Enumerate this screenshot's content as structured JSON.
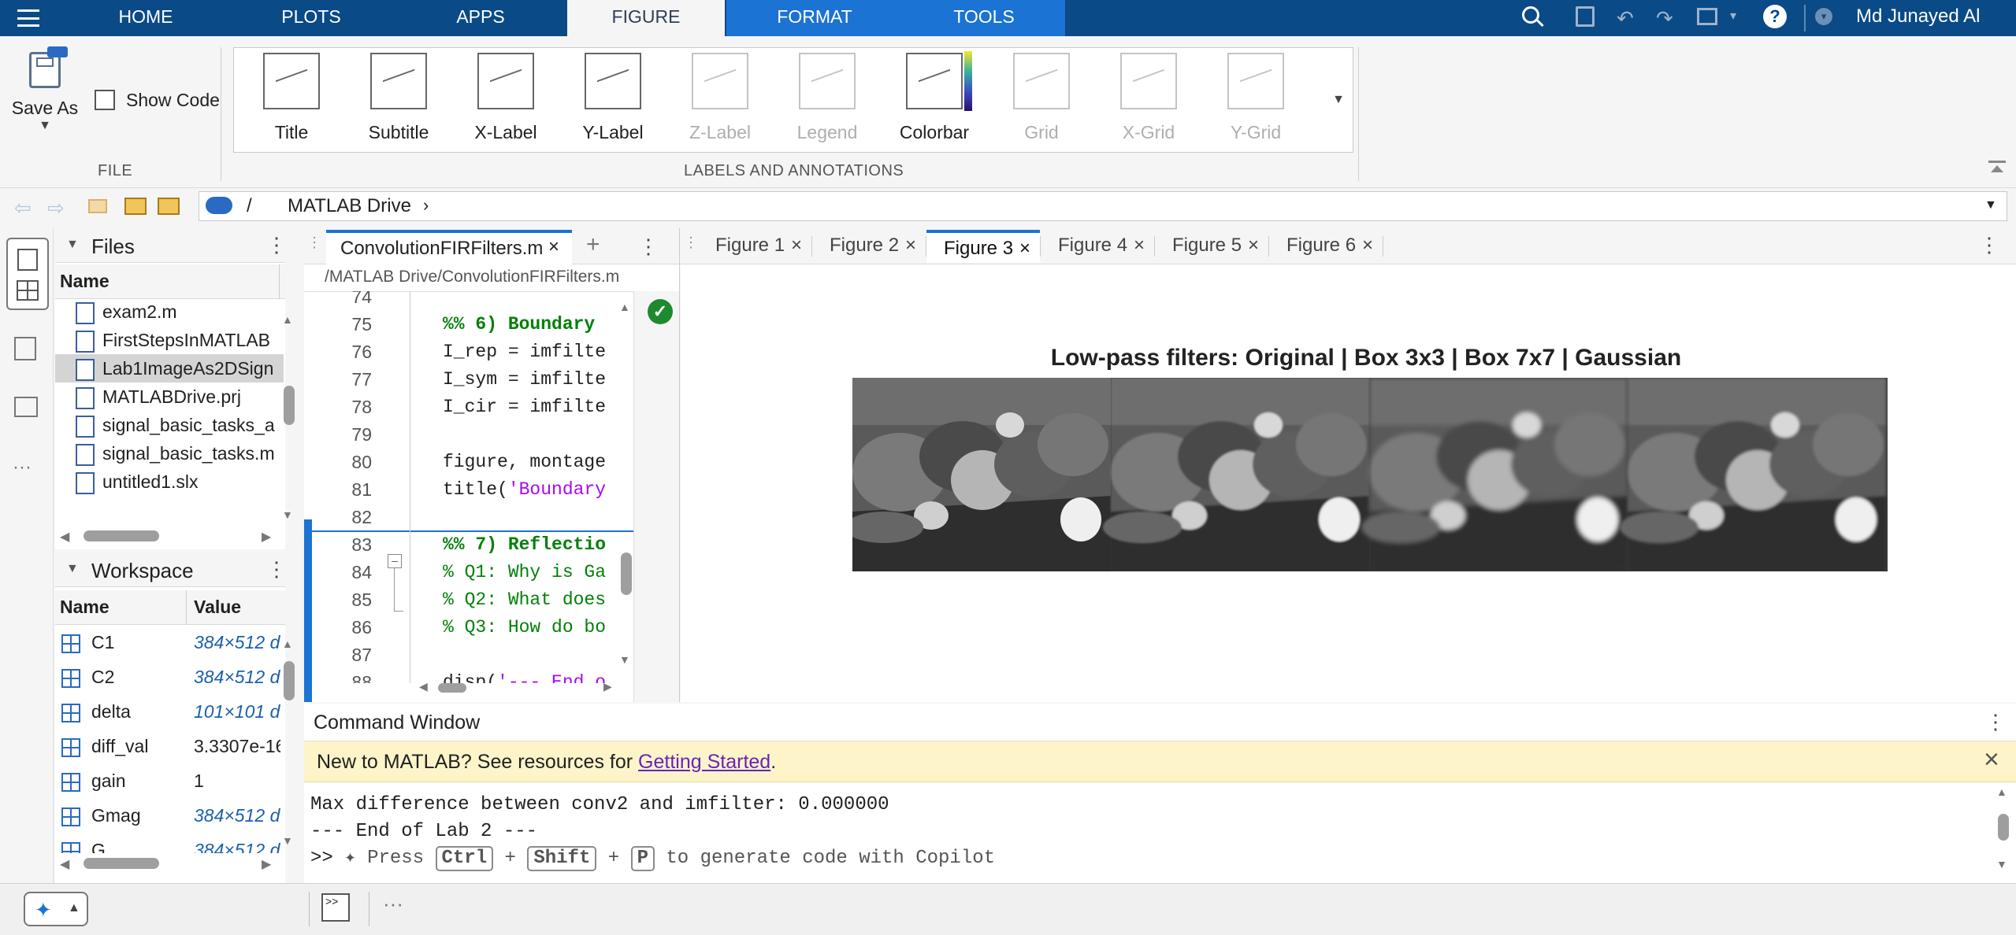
{
  "tabs": {
    "home": "HOME",
    "plots": "PLOTS",
    "apps": "APPS",
    "figure": "FIGURE",
    "format": "FORMAT",
    "tools": "TOOLS"
  },
  "user": "Md Junayed Al",
  "ribbon": {
    "save_as": "Save As",
    "show_code": "Show Code",
    "file_section": "FILE",
    "labels_section": "LABELS AND ANNOTATIONS",
    "gallery": [
      {
        "label": "Title",
        "enabled": true
      },
      {
        "label": "Subtitle",
        "enabled": true
      },
      {
        "label": "X-Label",
        "enabled": true
      },
      {
        "label": "Y-Label",
        "enabled": true
      },
      {
        "label": "Z-Label",
        "enabled": false
      },
      {
        "label": "Legend",
        "enabled": false
      },
      {
        "label": "Colorbar",
        "enabled": true
      },
      {
        "label": "Grid",
        "enabled": false
      },
      {
        "label": "X-Grid",
        "enabled": false
      },
      {
        "label": "Y-Grid",
        "enabled": false
      }
    ]
  },
  "address": {
    "root": "/",
    "folder": "MATLAB Drive"
  },
  "files": {
    "title": "Files",
    "col": "Name",
    "items": [
      "exam2.m",
      "FirstStepsInMATLAB",
      "Lab1ImageAs2DSign",
      "MATLABDrive.prj",
      "signal_basic_tasks_a",
      "signal_basic_tasks.m",
      "untitled1.slx"
    ]
  },
  "workspace": {
    "title": "Workspace",
    "col_name": "Name",
    "col_value": "Value",
    "rows": [
      {
        "name": "C1",
        "value": "384×512 d"
      },
      {
        "name": "C2",
        "value": "384×512 d"
      },
      {
        "name": "delta",
        "value": "101×101 d"
      },
      {
        "name": "diff_val",
        "value": "3.3307e-16"
      },
      {
        "name": "gain",
        "value": "1"
      },
      {
        "name": "Gmag",
        "value": "384×512 d"
      },
      {
        "name": "G",
        "value": "384×512 d"
      }
    ]
  },
  "editor": {
    "tab": "ConvolutionFIRFilters.m",
    "path": "/MATLAB Drive/ConvolutionFIRFilters.m",
    "lines": [
      {
        "n": "74",
        "code": ""
      },
      {
        "n": "75",
        "code": "%% 6) Boundary",
        "type": "section"
      },
      {
        "n": "76",
        "code": "I_rep = imfilte",
        "type": "code"
      },
      {
        "n": "77",
        "code": "I_sym = imfilte",
        "type": "code"
      },
      {
        "n": "78",
        "code": "I_cir = imfilte",
        "type": "code"
      },
      {
        "n": "79",
        "code": "",
        "type": "code"
      },
      {
        "n": "80",
        "code": "figure, montage",
        "type": "code"
      },
      {
        "n": "81",
        "code_a": "title(",
        "code_b": "'Boundary",
        "type": "title"
      },
      {
        "n": "82",
        "code": "",
        "type": "code"
      },
      {
        "n": "83",
        "code": "%% 7) Reflectio",
        "type": "section"
      },
      {
        "n": "84",
        "code": "% Q1: Why is Ga",
        "type": "comment"
      },
      {
        "n": "85",
        "code": "% Q2: What does",
        "type": "comment"
      },
      {
        "n": "86",
        "code": "% Q3: How do bo",
        "type": "comment"
      },
      {
        "n": "87",
        "code": "",
        "type": "code"
      },
      {
        "n": "88",
        "code_a": "disp(",
        "code_b": "'--- End o",
        "type": "title"
      }
    ]
  },
  "figures": {
    "tabs": [
      "Figure 1",
      "Figure 2",
      "Figure 3",
      "Figure 4",
      "Figure 5",
      "Figure 6"
    ],
    "active": "Figure 3",
    "plot_title": "Low-pass filters: Original | Box 3x3 | Box 7x7 | Gaussian"
  },
  "command": {
    "title": "Command Window",
    "banner_text": "New to MATLAB? See resources for ",
    "banner_link": "Getting Started",
    "banner_end": ".",
    "out1": "Max difference between conv2 and imfilter: 0.000000",
    "out2": "--- End of Lab 2 ---",
    "prompt": ">>",
    "hint_a": "Press",
    "k1": "Ctrl",
    "plus": "+",
    "k2": "Shift",
    "k3": "P",
    "hint_b": "to generate code with Copilot"
  },
  "colors": {
    "topbar": "#0a4a87",
    "contextual": "#1b73d3",
    "banner": "#fdf5c9",
    "comment": "#028009",
    "string": "#a709f5"
  }
}
